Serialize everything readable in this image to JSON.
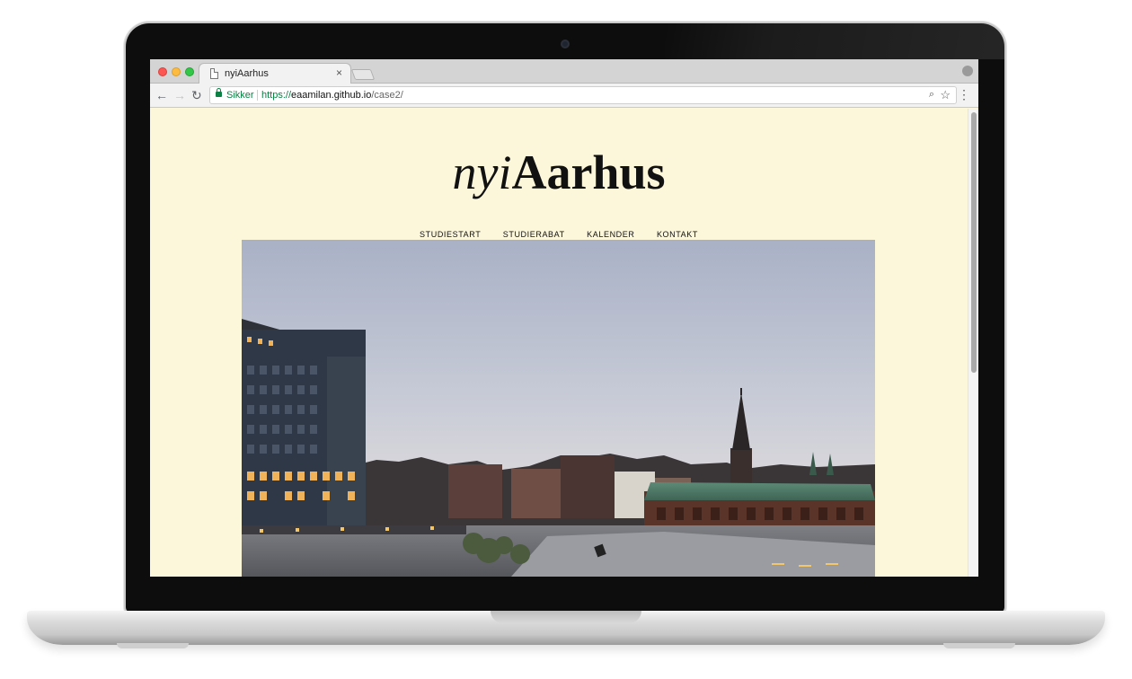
{
  "browser": {
    "tab_title": "nyiAarhus",
    "tab_close": "×",
    "secure_label": "Sikker",
    "url_scheme": "https://",
    "url_host": "eaamilan.github.io",
    "url_path": "/case2/",
    "icons": {
      "back": "←",
      "forward": "→",
      "reload": "↻",
      "zoom": "⌕",
      "star": "☆",
      "menu": "⋮"
    }
  },
  "site": {
    "logo_italic": "nyi",
    "logo_bold": "Aarhus",
    "nav": [
      "STUDIESTART",
      "STUDIERABAT",
      "KALENDER",
      "KONTAKT"
    ],
    "background_color": "#fcf6da"
  }
}
